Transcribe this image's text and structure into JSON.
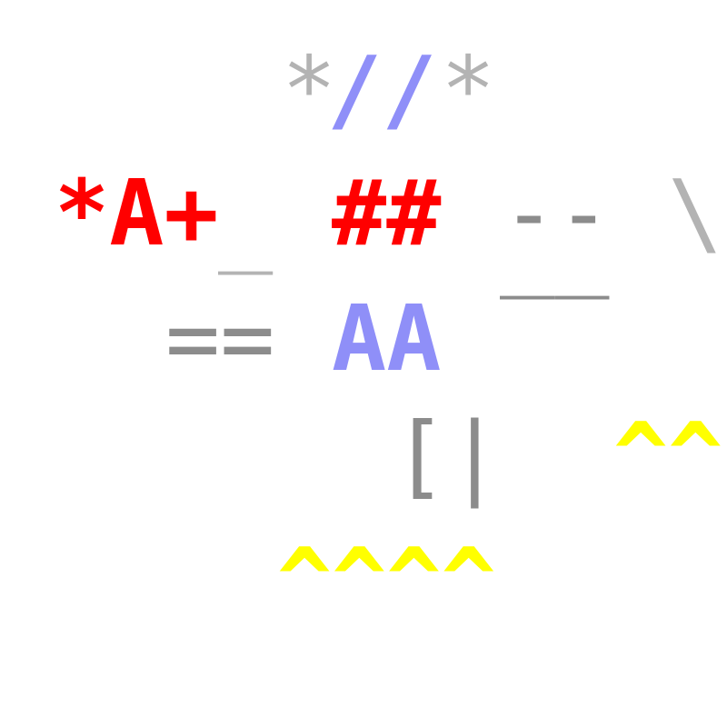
{
  "glyph_runs": [
    {
      "id": "comment-open-slash",
      "text": "*//*"
    },
    {
      "id": "star-a-plus",
      "text": "*A+"
    },
    {
      "id": "underscore-1",
      "text": "_"
    },
    {
      "id": "double-hash",
      "text": "##"
    },
    {
      "id": "double-dash",
      "text": "--"
    },
    {
      "id": "backslash",
      "text": "\\"
    },
    {
      "id": "long-underline",
      "text": "__"
    },
    {
      "id": "double-equals",
      "text": "=="
    },
    {
      "id": "double-a",
      "text": "AA"
    },
    {
      "id": "bracket-pipe",
      "text": "[|"
    },
    {
      "id": "caret-pair",
      "text": "^^"
    },
    {
      "id": "caret-quad",
      "text": "^^^^"
    }
  ],
  "colors": {
    "gray_light": "#b3b3b3",
    "gray_mid": "#8c8c8c",
    "blue": "#8f8ff8",
    "red": "#ff0000",
    "yellow": "#ffff00"
  }
}
